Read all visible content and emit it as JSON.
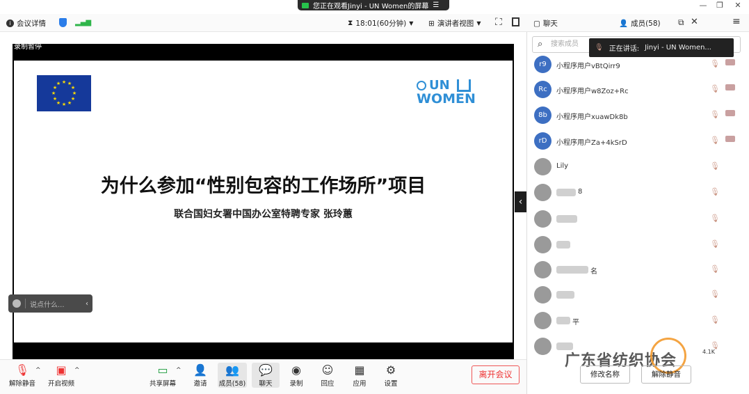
{
  "window": {
    "share_banner": "您正在观看Jinyi - UN Women的屏幕",
    "menu_glyph": "☰",
    "minimize": "—",
    "restore": "❐",
    "close": "✕"
  },
  "infobar": {
    "meeting_details": "会议详情",
    "timer": "18:01(60分钟)",
    "presenter_view": "演讲者视图"
  },
  "stage": {
    "recording_status": "录制暂停",
    "slide_title": "为什么参加“性别包容的工作场所”项目",
    "slide_subtitle": "联合国妇女署中国办公室特聘专家 张玲蕙",
    "un_logo_line1": "UN",
    "un_logo_line2": "WOMEN",
    "comment_placeholder": "说点什么...",
    "collapse_glyph": "‹"
  },
  "toolbar": {
    "unmute": "解除静音",
    "start_video": "开启视频",
    "share_screen": "共享屏幕",
    "invite": "邀请",
    "members": "成员(58)",
    "chat": "聊天",
    "record": "录制",
    "reactions": "回应",
    "apps": "应用",
    "settings": "设置",
    "leave": "离开会议"
  },
  "panel": {
    "tab_chat": "聊天",
    "tab_members": "成员(58)",
    "search_placeholder": "搜索成员",
    "speaking_label": "正在讲话:",
    "speaking_name": "Jinyi - UN Women...",
    "members": [
      {
        "initials": "r9",
        "name": "小程序用户vBtQirr9",
        "video": true
      },
      {
        "initials": "Rc",
        "name": "小程序用户w8Zoz+Rc",
        "video": true
      },
      {
        "initials": "8b",
        "name": "小程序用户xuawDk8b",
        "video": true
      },
      {
        "initials": "rD",
        "name": "小程序用户Za+4kSrD",
        "video": true
      },
      {
        "initials": "",
        "name": "Lily",
        "video": false
      },
      {
        "initials": "",
        "name": "8",
        "video": false
      },
      {
        "initials": "",
        "name": "",
        "video": false
      },
      {
        "initials": "",
        "name": "",
        "video": false
      },
      {
        "initials": "",
        "name": "名",
        "video": false
      },
      {
        "initials": "",
        "name": "",
        "video": false
      },
      {
        "initials": "",
        "name": "平",
        "video": false
      },
      {
        "initials": "",
        "name": "",
        "video": false
      }
    ],
    "rename": "修改名称",
    "unmute_all": "解除静音",
    "network": "4.1K"
  },
  "watermark": "广东省纺织协会",
  "colors": {
    "accent_blue": "#3d6fc2",
    "leave_red": "#e33333",
    "eu_blue": "#15399a",
    "un_blue": "#2f8fd6"
  }
}
